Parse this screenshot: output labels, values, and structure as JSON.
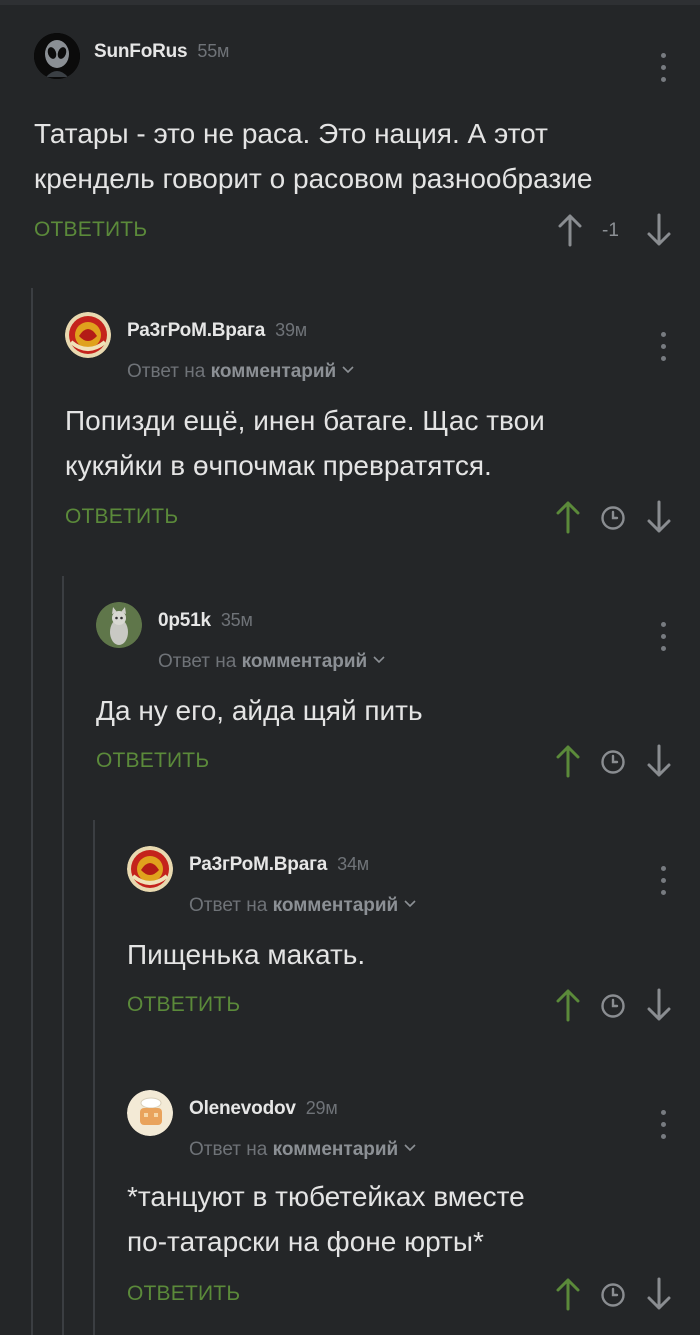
{
  "comments": [
    {
      "username": "SunFoRus",
      "time": "55м",
      "reply_prefix": "",
      "reply_target": "",
      "lines": [
        "Татары - это не раса. Это нация. А этот",
        "крендель говорит о расовом разнообразие"
      ],
      "reply_label": "ОТВЕТИТЬ",
      "score": "-1",
      "avatar": "alien-avatar",
      "vote_up_color": "#8a8d91"
    },
    {
      "username": "Ра3гРоМ.Врага",
      "time": "39м",
      "reply_prefix": "Ответ на",
      "reply_target": "комментарий",
      "lines": [
        "Попизди ещё, инен батаге. Щас твои",
        "кукяйки в өчпочмак превратятся."
      ],
      "reply_label": "ОТВЕТИТЬ",
      "avatar": "red-emblem-avatar",
      "vote_up_color": "#5b8a3a"
    },
    {
      "username": "0p51k",
      "time": "35м",
      "reply_prefix": "Ответ на",
      "reply_target": "комментарий",
      "lines": [
        "Да ну его, айда щяй пить"
      ],
      "reply_label": "ОТВЕТИТЬ",
      "avatar": "cat-avatar",
      "vote_up_color": "#5b8a3a"
    },
    {
      "username": "Ра3гРоМ.Врага",
      "time": "34м",
      "reply_prefix": "Ответ на",
      "reply_target": "комментарий",
      "lines": [
        "Пищенька макать."
      ],
      "reply_label": "ОТВЕТИТЬ",
      "avatar": "red-emblem-avatar",
      "vote_up_color": "#5b8a3a"
    },
    {
      "username": "Olenevodov",
      "time": "29м",
      "reply_prefix": "Ответ на",
      "reply_target": "комментарий",
      "lines": [
        "*танцуют в тюбетейках вместе",
        "по-татарски на фоне юрты*"
      ],
      "reply_label": "ОТВЕТИТЬ",
      "avatar": "cartoon-avatar",
      "vote_up_color": "#5b8a3a"
    }
  ],
  "colors": {
    "background": "#242628",
    "accent_green": "#5b8a3a",
    "muted_text": "#6f7378",
    "thread_line": "#3b3e42"
  }
}
